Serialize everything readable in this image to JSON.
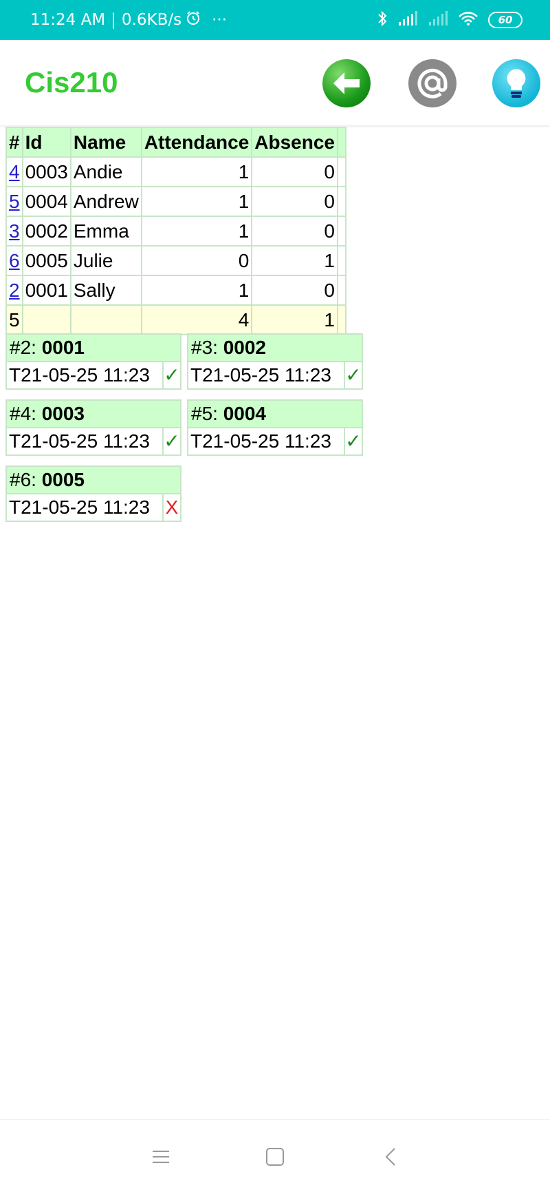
{
  "status": {
    "time": "11:24 AM",
    "speed": "0.6KB/s",
    "more": "···",
    "battery": "60"
  },
  "appbar": {
    "title": "Cis210",
    "back_icon": "back-arrow-icon",
    "at_icon": "at-sign-icon",
    "idea_icon": "lightbulb-icon"
  },
  "table": {
    "headers": [
      "#",
      "Id",
      "Name",
      "Attendance",
      "Absence"
    ],
    "rows": [
      {
        "no": "4",
        "id": "0003",
        "name": "Andie",
        "attendance": "1",
        "absence": "0"
      },
      {
        "no": "5",
        "id": "0004",
        "name": "Andrew",
        "attendance": "1",
        "absence": "0"
      },
      {
        "no": "3",
        "id": "0002",
        "name": "Emma",
        "attendance": "1",
        "absence": "0"
      },
      {
        "no": "6",
        "id": "0005",
        "name": "Julie",
        "attendance": "0",
        "absence": "1"
      },
      {
        "no": "2",
        "id": "0001",
        "name": "Sally",
        "attendance": "1",
        "absence": "0"
      }
    ],
    "total": {
      "count": "5",
      "attendance": "4",
      "absence": "1"
    }
  },
  "cards": [
    {
      "num": "#2: ",
      "id": "0001",
      "time": "T21-05-25 11:23",
      "mark": "✓"
    },
    {
      "num": "#3: ",
      "id": "0002",
      "time": "T21-05-25 11:23",
      "mark": "✓"
    },
    {
      "num": "#4: ",
      "id": "0003",
      "time": "T21-05-25 11:23",
      "mark": "✓"
    },
    {
      "num": "#5: ",
      "id": "0004",
      "time": "T21-05-25 11:23",
      "mark": "✓"
    },
    {
      "num": "#6: ",
      "id": "0005",
      "time": "T21-05-25 11:23",
      "mark": "X"
    }
  ],
  "colors": {
    "statusbar": "#00c4c4",
    "title": "#33cc33",
    "header_bg": "#ccffcc",
    "total_bg": "#ffffdd",
    "check": "#1a8a1a",
    "cross": "#e02020"
  }
}
